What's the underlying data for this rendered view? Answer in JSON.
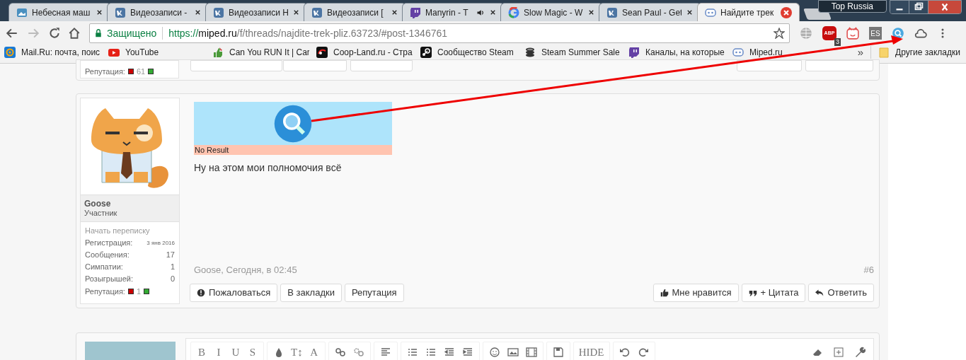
{
  "tabs": [
    {
      "title": "Небесная маш",
      "kind": "picture",
      "selected": false,
      "audio": false
    },
    {
      "title": "Видеозаписи -",
      "kind": "vk",
      "selected": false,
      "audio": false
    },
    {
      "title": "Видеозаписи Н",
      "kind": "vk",
      "selected": false,
      "audio": false
    },
    {
      "title": "Видеозаписи [",
      "kind": "vk",
      "selected": false,
      "audio": false
    },
    {
      "title": "Manyrin - T",
      "kind": "twitch",
      "selected": false,
      "audio": true
    },
    {
      "title": "Slow Magic - W",
      "kind": "google",
      "selected": false,
      "audio": false
    },
    {
      "title": "Sean Paul - Get",
      "kind": "vk",
      "selected": false,
      "audio": false
    },
    {
      "title": "Найдите трек",
      "kind": "miped",
      "selected": true,
      "audio": false
    }
  ],
  "profile": "Top Russia",
  "address_bar": {
    "secure_label": "Защищено",
    "url_scheme": "https://",
    "url_host": "miped.ru",
    "url_path": "/f/threads/najdite-trek-pliz.63723/#post-1346761"
  },
  "extensions": [
    {
      "kind": "globe"
    },
    {
      "kind": "abp",
      "label": "ABP",
      "badge": "3"
    },
    {
      "kind": "cat"
    },
    {
      "kind": "es",
      "label": "ES"
    },
    {
      "kind": "search"
    },
    {
      "kind": "cloud"
    }
  ],
  "bookmarks": [
    {
      "label": "Mail.Ru: почта, поис",
      "kind": "mail"
    },
    {
      "label": "YouTube",
      "kind": "youtube"
    },
    {
      "label": "Can You RUN It | Car",
      "kind": "thumbs"
    },
    {
      "label": "Coop-Land.ru - Стра",
      "kind": "coop"
    },
    {
      "label": "Сообщество Steam",
      "kind": "steam"
    },
    {
      "label": "Steam Summer Sale",
      "kind": "coins"
    },
    {
      "label": "Каналы, на которые",
      "kind": "twitch"
    },
    {
      "label": "Miped.ru",
      "kind": "miped"
    }
  ],
  "bookmarks_more": "»",
  "other_bookmarks": "Другие закладки",
  "previous_post": {
    "reputation_label": "Репутация:",
    "reputation_value": "61"
  },
  "post": {
    "author": "Goose",
    "role": "Участник",
    "start_conversation": "Начать переписку",
    "stats": [
      {
        "label": "Регистрация:",
        "value": "3 янв 2016"
      },
      {
        "label": "Сообщения:",
        "value": "17"
      },
      {
        "label": "Симпатии:",
        "value": "1"
      },
      {
        "label": "Розыгрышей:",
        "value": "0"
      }
    ],
    "reputation_label": "Репутация:",
    "reputation_value": "1",
    "attachment_caption": "No Result",
    "message": "Ну на этом мои полномочия всё",
    "meta": "Goose, Сегодня, в 02:45",
    "number": "#6",
    "actions_left": [
      {
        "label": "Пожаловаться",
        "kind": "alert"
      },
      {
        "label": "В закладки",
        "kind": "plain"
      },
      {
        "label": "Репутация",
        "kind": "plain"
      }
    ],
    "actions_right": [
      {
        "label": "Мне нравится",
        "kind": "like"
      },
      {
        "label": "+ Цитата",
        "kind": "quote"
      },
      {
        "label": "Ответить",
        "kind": "reply"
      }
    ]
  },
  "editor_toolbar": [
    [
      {
        "kind": "text",
        "label": "B"
      },
      {
        "kind": "text",
        "label": "I"
      },
      {
        "kind": "text",
        "label": "U"
      },
      {
        "kind": "text",
        "label": "S"
      }
    ],
    [
      {
        "kind": "drop"
      },
      {
        "kind": "text",
        "label": "T↕"
      },
      {
        "kind": "text",
        "label": "A"
      }
    ],
    [
      {
        "kind": "link"
      },
      {
        "kind": "unlink"
      }
    ],
    [
      {
        "kind": "align"
      }
    ],
    [
      {
        "kind": "list"
      },
      {
        "kind": "list"
      },
      {
        "kind": "outdent"
      },
      {
        "kind": "indent"
      }
    ],
    [
      {
        "kind": "smile"
      },
      {
        "kind": "image"
      },
      {
        "kind": "film"
      }
    ],
    [
      {
        "kind": "save"
      }
    ],
    [
      {
        "kind": "text",
        "label": "HIDE"
      }
    ],
    [
      {
        "kind": "undo"
      },
      {
        "kind": "redo"
      }
    ]
  ],
  "editor_toolbar_right": [
    {
      "kind": "eraser"
    },
    {
      "kind": "plus"
    },
    {
      "kind": "wrench"
    }
  ]
}
